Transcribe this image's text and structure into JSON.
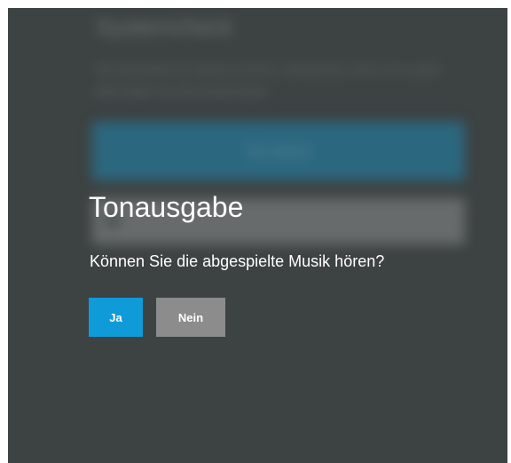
{
  "background_screen": {
    "title": "Systemcheck",
    "description": "Wir überprüfen Ihr System und Ihre Lautsprecher, bevor es los geht. Bitte folgen Sie den Anweisungen.",
    "button_label": "Test starten"
  },
  "dialog": {
    "title": "Tonausgabe",
    "question": "Können Sie die abgespielte Musik hören?",
    "yes_label": "Ja",
    "no_label": "Nein"
  },
  "colors": {
    "overlay": "#3d4242",
    "primary_button": "#0e9bd8",
    "secondary_button": "#8c8c8c",
    "text": "#ffffff"
  }
}
